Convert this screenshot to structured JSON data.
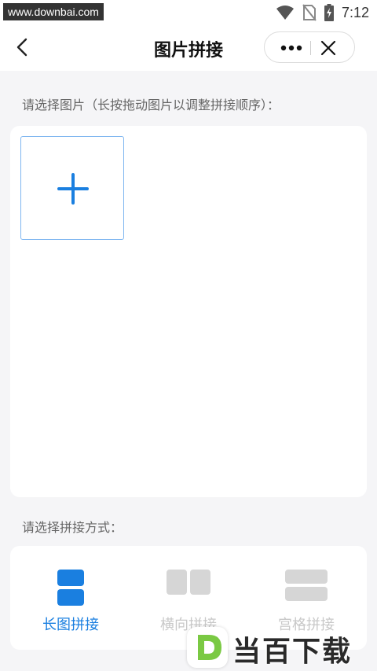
{
  "status_bar": {
    "watermark": "www.downbai.com",
    "time": "7:12",
    "icons": [
      "wifi-icon",
      "no-sim-icon",
      "battery-charging-icon"
    ]
  },
  "nav": {
    "title": "图片拼接",
    "back_icon": "chevron-left-icon",
    "more_icon": "more-dots-icon",
    "close_icon": "close-icon"
  },
  "image_section": {
    "label": "请选择图片（长按拖动图片以调整拼接顺序）：",
    "add_icon": "plus-icon"
  },
  "mode_section": {
    "label": "请选择拼接方式：",
    "modes": [
      {
        "label": "长图拼接",
        "icon": "vertical-stitch-icon",
        "active": true
      },
      {
        "label": "横向拼接",
        "icon": "horizontal-stitch-icon",
        "active": false
      },
      {
        "label": "宫格拼接",
        "icon": "grid-stitch-icon",
        "active": false
      }
    ]
  },
  "brand": {
    "mark": "D",
    "text": "当百下载"
  },
  "colors": {
    "accent": "#1a7fe0",
    "inactive": "#d6d6d6",
    "background": "#f5f5f7"
  }
}
